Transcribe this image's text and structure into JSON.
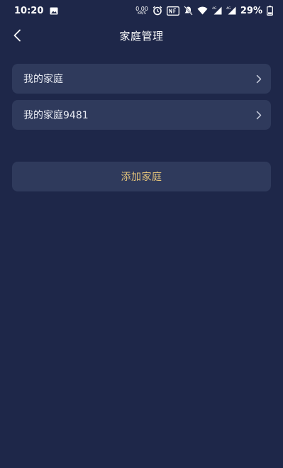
{
  "status_bar": {
    "time": "10:20",
    "net_speed_value": "0.00",
    "net_speed_unit": "KB/S",
    "battery_percent": "29%",
    "icons": [
      "image-icon",
      "alarm-icon",
      "nfc-icon",
      "mute-icon",
      "wifi-icon",
      "signal-4g-icon",
      "signal-4g-icon",
      "battery-icon"
    ]
  },
  "header": {
    "title": "家庭管理",
    "back_icon": "chevron-left-icon"
  },
  "families": [
    {
      "name": "我的家庭"
    },
    {
      "name": "我的家庭9481"
    }
  ],
  "add_button": {
    "label": "添加家庭"
  },
  "colors": {
    "background": "#1e2749",
    "card": "#2f3a5c",
    "accent_gold": "#e3c37a",
    "text": "#e8ebf3"
  }
}
